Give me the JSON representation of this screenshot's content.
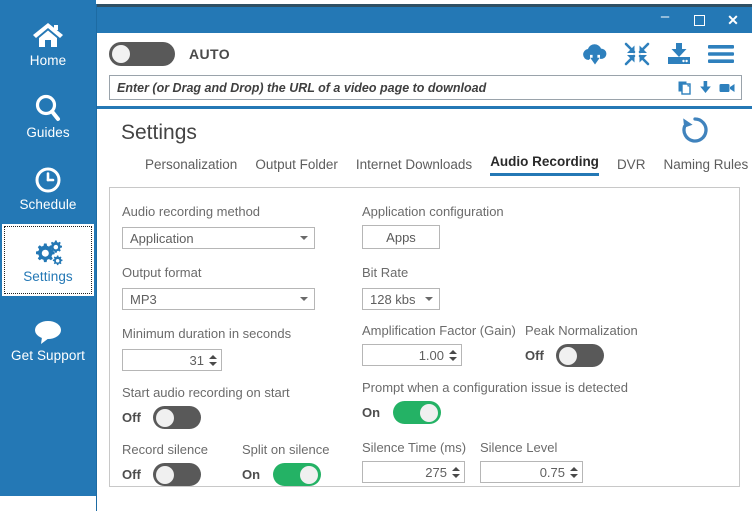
{
  "sidebar": {
    "items": [
      {
        "label": "Home",
        "icon": "home-icon",
        "active": false
      },
      {
        "label": "Guides",
        "icon": "search-icon",
        "active": false
      },
      {
        "label": "Schedule",
        "icon": "clock-icon",
        "active": false
      },
      {
        "label": "Settings",
        "icon": "gears-icon",
        "active": true
      },
      {
        "label": "Get Support",
        "icon": "chat-icon",
        "active": false
      }
    ]
  },
  "window": {
    "title": "",
    "controls": {
      "minimize": "–",
      "maximize": "",
      "close": "✕"
    }
  },
  "toolbar": {
    "auto_label": "AUTO",
    "auto_state": "off",
    "icons": [
      {
        "name": "cloud-download-icon"
      },
      {
        "name": "collapse-arrows-icon"
      },
      {
        "name": "download-tray-icon"
      },
      {
        "name": "hamburger-menu-icon"
      }
    ]
  },
  "urlbar": {
    "value": "",
    "placeholder": "Enter (or Drag and Drop) the URL of a video page to download",
    "icons": [
      {
        "name": "paste-clipboard-icon"
      },
      {
        "name": "down-arrow-icon"
      },
      {
        "name": "video-camera-icon"
      }
    ]
  },
  "settings": {
    "title": "Settings",
    "reset_icon": "reset-circular-arrow-icon",
    "tabs": [
      {
        "label": "Personalization",
        "active": false
      },
      {
        "label": "Output Folder",
        "active": false
      },
      {
        "label": "Internet Downloads",
        "active": false
      },
      {
        "label": "Audio Recording",
        "active": true
      },
      {
        "label": "DVR",
        "active": false
      },
      {
        "label": "Naming Rules",
        "active": false
      }
    ],
    "fields": {
      "audio_recording_method": {
        "label": "Audio recording method",
        "value": "Application"
      },
      "output_format": {
        "label": "Output format",
        "value": "MP3"
      },
      "minimum_duration": {
        "label": "Minimum duration in seconds",
        "value": "31"
      },
      "application_configuration": {
        "label": "Application configuration",
        "button_label": "Apps"
      },
      "bit_rate": {
        "label": "Bit Rate",
        "value": "128 kbs"
      },
      "amplification_factor": {
        "label": "Amplification Factor (Gain)",
        "value": "1.00"
      },
      "peak_normalization": {
        "label": "Peak Normalization",
        "state": "Off"
      },
      "start_audio_recording_on_start": {
        "label": "Start audio recording on start",
        "state": "Off"
      },
      "prompt_on_config_issue": {
        "label": "Prompt when a configuration issue is detected",
        "state": "On"
      },
      "record_silence": {
        "label": "Record silence",
        "state": "Off"
      },
      "split_on_silence": {
        "label": "Split on silence",
        "state": "On"
      },
      "silence_time": {
        "label": "Silence Time (ms)",
        "value": "275"
      },
      "silence_level": {
        "label": "Silence Level",
        "value": "0.75"
      }
    }
  },
  "colors": {
    "brand_blue": "#2478b5",
    "toggle_on_green": "#24b265",
    "toggle_off_gray": "#595959",
    "titlebar_top": "#2f4f63"
  }
}
